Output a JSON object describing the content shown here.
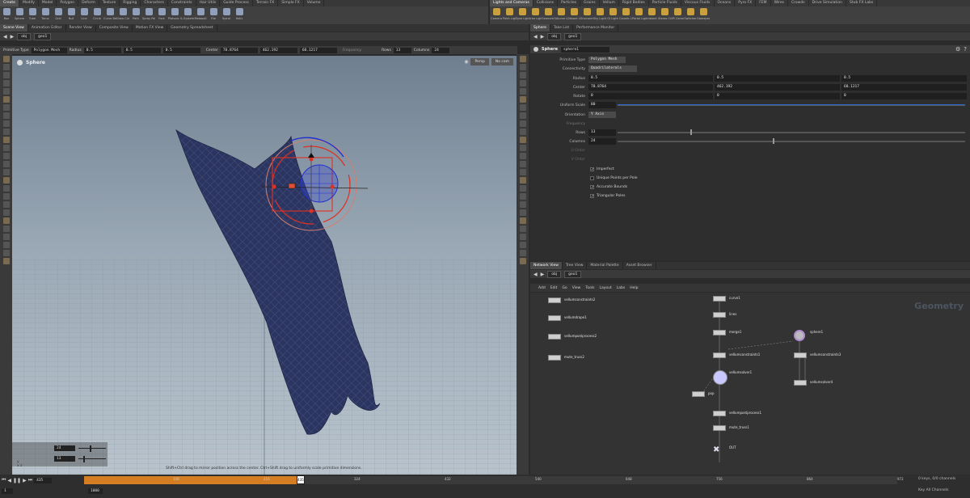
{
  "shelf_tabs_left": [
    "Create",
    "Modify",
    "Model",
    "Polygon",
    "Deform",
    "Texture",
    "Rigging",
    "Characters",
    "Constraints",
    "Hair Utils",
    "Guide Process",
    "Terrain FX",
    "Simple FX",
    "Volume"
  ],
  "shelf_tabs_right": [
    "Lights and Cameras",
    "Collisions",
    "Particles",
    "Grains",
    "Vellum",
    "Rigid Bodies",
    "Particle Fluids",
    "Viscous Fluids",
    "Oceans",
    "Pyro FX",
    "FEM",
    "Wires",
    "Crowds",
    "Drive Simulation",
    "Stub FX Labs"
  ],
  "tools_left": [
    "Box",
    "Sphere",
    "Tube",
    "Torus",
    "Grid",
    "Null",
    "Line",
    "Circle",
    "Curve Bezier",
    "Draw Curve",
    "Path",
    "Spray Paint",
    "Font",
    "Platonic Solids",
    "L-System",
    "Metaball",
    "File",
    "Spiral",
    "Helix"
  ],
  "tools_right": [
    "Camera",
    "Point Light",
    "Spot Light",
    "Area Light",
    "Geometry Light",
    "Volume Light",
    "Distant Light",
    "Environment Light",
    "Sky Light",
    "GI Light",
    "Caustic Light",
    "Portal Light",
    "Ambient Light",
    "Stereo Camera",
    "VR Camera",
    "Switcher",
    "Gamepad Camera"
  ],
  "left_pane_tabs": [
    "Scene View",
    "Animation Editor",
    "Render View",
    "Composite View",
    "Motion FX View",
    "Geometry Spreadsheet"
  ],
  "left_path": {
    "obj": "obj",
    "node": "geo1"
  },
  "sphere_opts": {
    "primitive_type_label": "Primitive Type",
    "primitive_type": "Polygon Mesh",
    "radius_label": "Radius",
    "radius": [
      "0.5",
      "0.5",
      "0.5"
    ],
    "center_label": "Center",
    "center": [
      "78.8764",
      "462.192",
      "68.1217"
    ],
    "frequency_label": "Frequency",
    "rows_label": "Rows",
    "rows": "13",
    "columns_label": "Columns",
    "columns": "24"
  },
  "viewport": {
    "title": "Sphere",
    "persp_label": "Persp",
    "cam_label": "No cam",
    "hint": "Shift+Ctrl drag to mirror position across the center. Ctrl+Shift drag to uniformly scale primitive dimensions.",
    "hud_values": [
      "24",
      "13"
    ]
  },
  "right_pane_tabs": [
    "Sphere",
    "Take List",
    "Performance Monitor"
  ],
  "right_path": {
    "obj": "obj",
    "node": "geo1"
  },
  "parm_header": {
    "type": "Sphere",
    "name": "sphere1"
  },
  "parms": {
    "primitive_type_label": "Primitive Type",
    "primitive_type": "Polygon Mesh",
    "connectivity_label": "Connectivity",
    "connectivity": "Quadrilaterals",
    "radius_label": "Radius",
    "radius": [
      "0.5",
      "0.5",
      "0.5"
    ],
    "center_label": "Center",
    "center": [
      "78.8764",
      "462.192",
      "68.1217"
    ],
    "rotate_label": "Rotate",
    "rotate": [
      "0",
      "0",
      "0"
    ],
    "uniform_scale_label": "Uniform Scale",
    "uniform_scale": "80",
    "orientation_label": "Orientation",
    "orientation": "Y Axis",
    "frequency_label": "Frequency",
    "rows_label": "Rows",
    "rows": "13",
    "columns_label": "Columns",
    "columns": "24",
    "u_order_label": "U Order",
    "v_order_label": "V Order",
    "checks": [
      {
        "label": "Imperfect",
        "checked": true
      },
      {
        "label": "Unique Points per Pole",
        "checked": false
      },
      {
        "label": "Accurate Bounds",
        "checked": true
      },
      {
        "label": "Triangular Poles",
        "checked": true
      }
    ]
  },
  "net_pane_tabs": [
    "Network View",
    "Tree View",
    "Material Palette",
    "Asset Browser"
  ],
  "net_path": {
    "obj": "obj",
    "node": "geo1"
  },
  "net_menu": [
    "Add",
    "Edit",
    "Go",
    "View",
    "Tools",
    "Layout",
    "Labs",
    "Help"
  ],
  "net_watermark": "Geometry",
  "nodes": [
    {
      "name": "vellumconstraints2",
      "sub": ""
    },
    {
      "name": "vellumdrape1",
      "sub": ""
    },
    {
      "name": "vellumpostprocess2",
      "sub": ""
    },
    {
      "name": "mute_truss2",
      "sub": ""
    },
    {
      "name": "curve1",
      "sub": ""
    },
    {
      "name": "lines",
      "sub": ""
    },
    {
      "name": "merge1",
      "sub": ""
    },
    {
      "name": "vellumconstraints1",
      "sub": ""
    },
    {
      "name": "vellumsolver1",
      "sub": ""
    },
    {
      "name": "pop",
      "sub": ""
    },
    {
      "name": "vellumpostprocess1",
      "sub": ""
    },
    {
      "name": "mute_truss1",
      "sub": ""
    },
    {
      "name": "OUT",
      "sub": ""
    },
    {
      "name": "sphere1",
      "sub": ""
    },
    {
      "name": "vellumconstraints3",
      "sub": ""
    },
    {
      "name": "vellumsolver4",
      "sub": ""
    }
  ],
  "timeline": {
    "current_frame": "435",
    "start": "1",
    "end": "1000",
    "ticks": [
      "108",
      "216",
      "324",
      "432",
      "540",
      "648",
      "756",
      "864",
      "972"
    ],
    "playhead_label": "435",
    "keys_text": "0 keys, 0/0 channels",
    "all_channels": "Key All Channels"
  },
  "colors": {
    "accent": "#f08a20",
    "viewport_top": "#6f7f90",
    "cloth": "#2c3560",
    "handle_red": "#e03020",
    "handle_blue": "#2030d0"
  }
}
